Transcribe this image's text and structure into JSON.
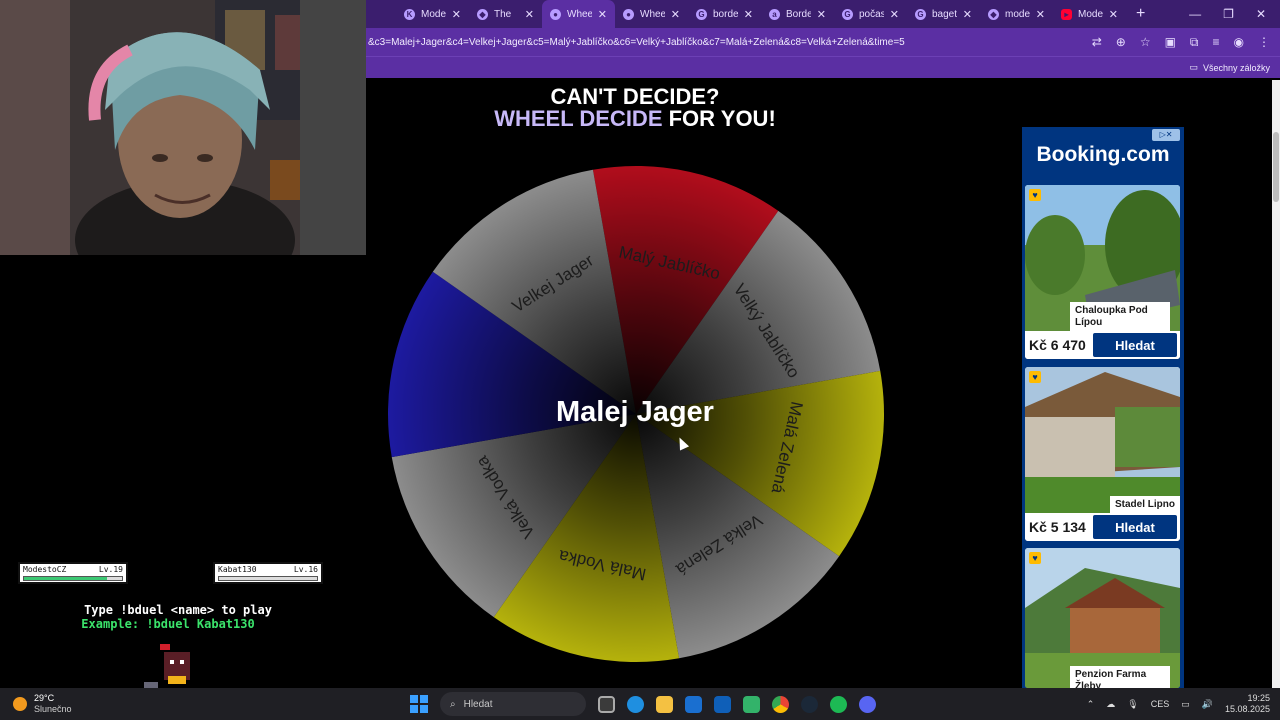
{
  "browser": {
    "tabs": [
      {
        "label": "Modes",
        "icon": "k-icon"
      },
      {
        "label": "The",
        "icon": "diamond-icon"
      },
      {
        "label": "Wheel",
        "icon": "wheel-icon",
        "active": true
      },
      {
        "label": "Wheel",
        "icon": "wheel-icon"
      },
      {
        "label": "border",
        "icon": "google-icon"
      },
      {
        "label": "Border",
        "icon": "wiki-icon"
      },
      {
        "label": "počasí",
        "icon": "google-icon"
      },
      {
        "label": "bageta",
        "icon": "google-icon"
      },
      {
        "label": "modes",
        "icon": "diamond-icon"
      },
      {
        "label": "Modes",
        "icon": "youtube-icon"
      }
    ],
    "url": "&c3=Malej+Jager&c4=Velkej+Jager&c5=Malý+Jablíčko&c6=Velký+Jablíčko&c7=Malá+Zelená&c8=Velká+Zelená&time=5",
    "bookmarks_label": "Všechny záložky"
  },
  "page": {
    "headline_line1": "CAN'T DECIDE?",
    "headline_accent": "WHEEL DECIDE",
    "headline_rest": " FOR YOU!",
    "winner": "Malej Jager",
    "wheel": {
      "slices": [
        {
          "label": "Malý Jablíčko",
          "color": "#b10d1c"
        },
        {
          "label": "Velký Jablíčko",
          "color": "#8c8c8c"
        },
        {
          "label": "Malá Zelená",
          "color": "#b5b20c"
        },
        {
          "label": "Velká Zelená",
          "color": "#8c8c8c"
        },
        {
          "label": "Malá Vodka",
          "color": "#b5b20c"
        },
        {
          "label": "Velká Vodka",
          "color": "#8c8c8c"
        },
        {
          "label": "Malej Jager",
          "color": "#1d1aa0"
        },
        {
          "label": "Velkej Jager",
          "color": "#8c8c8c"
        }
      ]
    }
  },
  "ad": {
    "badge": "▷✕",
    "logo": "Booking.com",
    "cards": [
      {
        "name": "Chaloupka Pod Lípou",
        "price": "Kč 6 470",
        "cta": "Hledat"
      },
      {
        "name": "Stadel Lipno",
        "price": "Kč 5 134",
        "cta": "Hledat"
      },
      {
        "name": "Penzion Farma Žleby",
        "price": "",
        "cta": ""
      }
    ]
  },
  "overlay": {
    "player1": {
      "name": "ModestoCZ",
      "level": "Lv.19",
      "hp_label": "HP:",
      "hp": 0.85
    },
    "player2": {
      "name": "Kabat130",
      "level": "Lv.16",
      "hp_label": "HP:",
      "hp": 0.0
    },
    "duel_line1": "Type !bduel <name> to play",
    "duel_line2": "Example: !bduel Kabat130"
  },
  "taskbar": {
    "temp": "29°C",
    "weather": "Slunečno",
    "search_placeholder": "Hledat",
    "lang": "CES",
    "time": "19:25",
    "date": "15.08.2025"
  }
}
